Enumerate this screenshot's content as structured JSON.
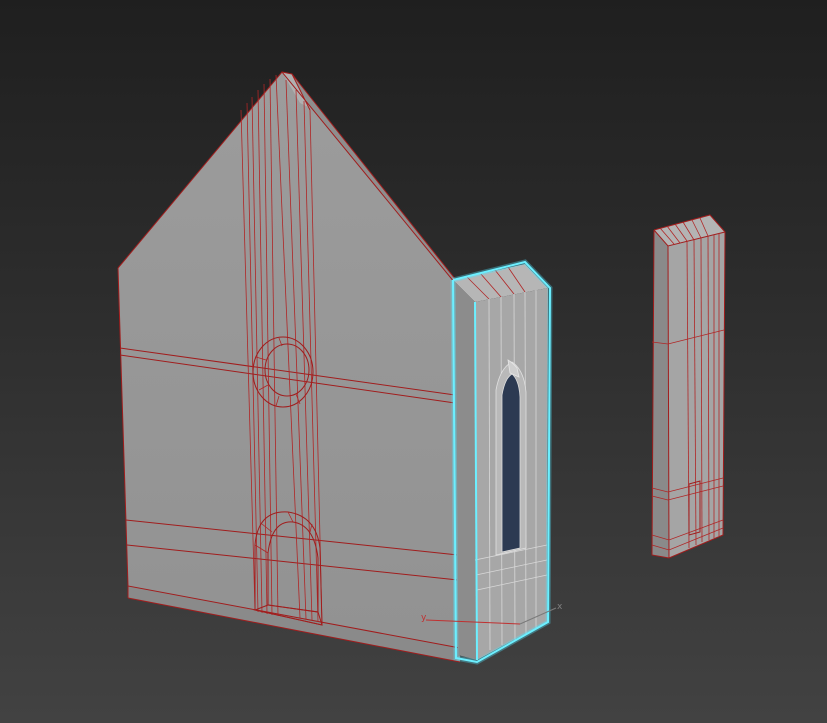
{
  "viewport": {
    "background_top": "#1f1f1f",
    "background_bottom": "#424242",
    "wireframe_color": "#a11d1d",
    "selection_color": "#6cefff"
  },
  "gizmo": {
    "y_label": "y",
    "x_label": "x",
    "y_color": "#c03030",
    "x_color": "#808080"
  }
}
